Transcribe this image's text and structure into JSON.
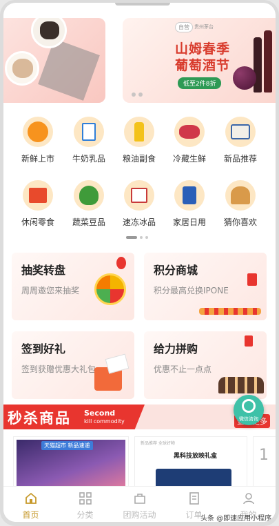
{
  "banner": {
    "badge": "自营",
    "badge_small": "贵州茅台",
    "title_line1": "山姆春季",
    "title_line2": "葡萄酒节",
    "pill": "低至2件8折"
  },
  "categories": [
    {
      "label": "新鲜上市",
      "icon": "orange-icon"
    },
    {
      "label": "牛奶乳品",
      "icon": "milk-icon"
    },
    {
      "label": "粮油副食",
      "icon": "oil-icon"
    },
    {
      "label": "冷藏生鲜",
      "icon": "meat-icon"
    },
    {
      "label": "新品推荐",
      "icon": "new-product-icon"
    },
    {
      "label": "休闲零食",
      "icon": "snack-icon"
    },
    {
      "label": "蔬菜豆品",
      "icon": "vegetable-icon"
    },
    {
      "label": "速冻冰品",
      "icon": "frozen-icon"
    },
    {
      "label": "家居日用",
      "icon": "tissue-icon"
    },
    {
      "label": "猜你喜欢",
      "icon": "bread-icon"
    }
  ],
  "promos": [
    {
      "title": "抽奖转盘",
      "subtitle": "周周邀您来抽奖"
    },
    {
      "title": "积分商城",
      "subtitle": "积分最高兑换IPONE"
    },
    {
      "title": "签到好礼",
      "subtitle": "签到获赠优惠大礼包"
    },
    {
      "title": "给力拼购",
      "subtitle": "优惠不止一点点"
    }
  ],
  "flash_sale": {
    "title": "秒杀商品",
    "en_line1": "Second",
    "en_line2": "kill commodity",
    "more": "查看更多"
  },
  "float_button": {
    "label": "微信咨询"
  },
  "products": [
    {
      "tag": "天猫超市 新品速递",
      "caption": ""
    },
    {
      "caption": "新品推荐 全球好物",
      "title": "黑科技放映礼盒"
    },
    {
      "caption": "1"
    }
  ],
  "tabbar": [
    {
      "label": "首页",
      "icon": "home-icon"
    },
    {
      "label": "分类",
      "icon": "grid-icon"
    },
    {
      "label": "团购活动",
      "icon": "bag-icon"
    },
    {
      "label": "订单",
      "icon": "order-icon"
    },
    {
      "label": "我的",
      "icon": "user-icon"
    }
  ],
  "watermark": "头条 @即速应用小程序",
  "colors": {
    "accent": "#e8352f",
    "tab_active": "#c79a2c",
    "wine_title": "#d83b2c",
    "float": "#3ec1a8"
  }
}
